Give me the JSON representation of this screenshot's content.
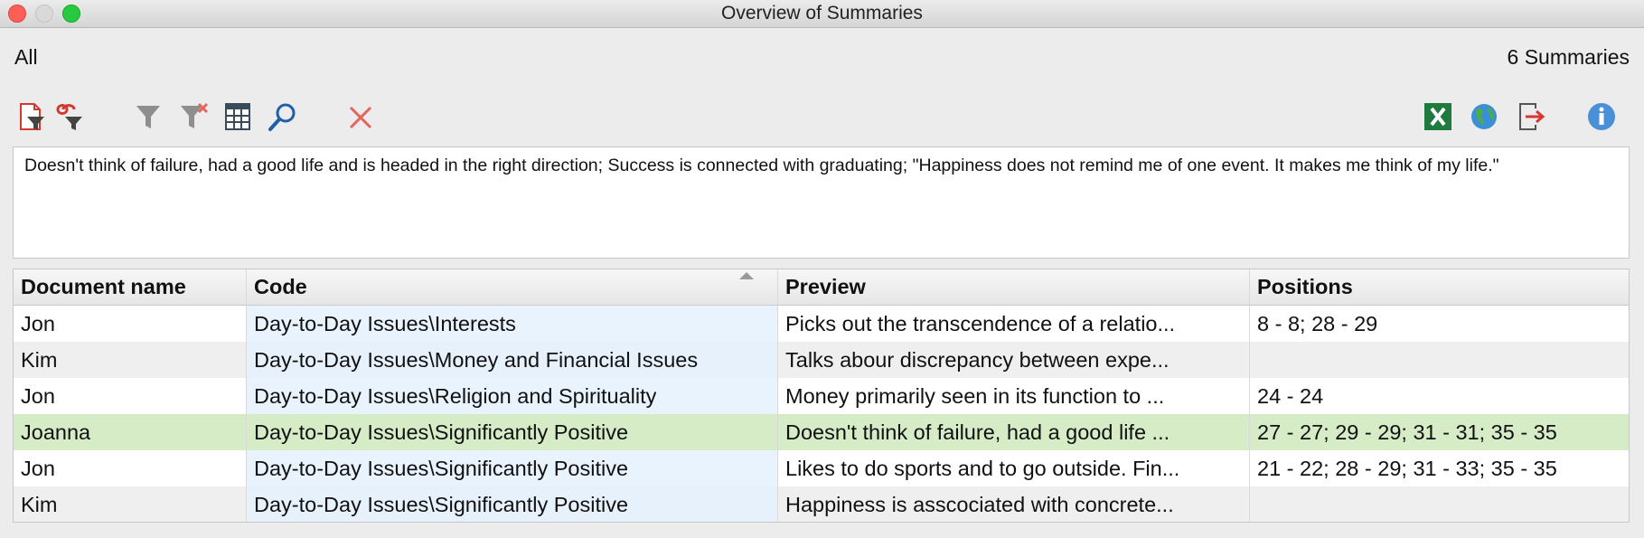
{
  "window": {
    "title": "Overview of Summaries"
  },
  "header": {
    "filter_label": "All",
    "count_label": "6 Summaries"
  },
  "toolbar": {
    "left_icons": [
      "document-filter-icon",
      "link-filter-icon",
      "filter-icon",
      "clear-filter-icon",
      "columns-icon",
      "search-icon",
      "delete-icon"
    ],
    "right_icons": [
      "excel-export-icon",
      "globe-export-icon",
      "export-icon",
      "info-icon"
    ]
  },
  "summary_text": "Doesn't think of failure, had a good life and is headed in the right direction; Success is connected with graduating; \"Happiness does not remind me of one event. It makes me think of my life.\"",
  "table": {
    "columns": [
      "Document name",
      "Code",
      "Preview",
      "Positions"
    ],
    "sorted_column": "Code",
    "rows": [
      {
        "document": "Jon",
        "code": "Day-to-Day Issues\\Interests",
        "preview": "Picks out the transcendence of a relatio...",
        "positions": "8 - 8; 28 - 29"
      },
      {
        "document": "Kim",
        "code": "Day-to-Day Issues\\Money and Financial Issues",
        "preview": "Talks abour discrepancy between expe...",
        "positions": ""
      },
      {
        "document": "Jon",
        "code": "Day-to-Day Issues\\Religion and Spirituality",
        "preview": "Money primarily seen in its function to ...",
        "positions": "24 - 24"
      },
      {
        "document": "Joanna",
        "code": "Day-to-Day Issues\\Significantly Positive",
        "preview": "Doesn't think of failure, had a good life ...",
        "positions": "27 - 27; 29 - 29; 31 - 31; 35 - 35"
      },
      {
        "document": "Jon",
        "code": "Day-to-Day Issues\\Significantly Positive",
        "preview": "Likes to do sports and to go outside. Fin...",
        "positions": "21 - 22; 28 - 29; 31 - 33; 35 - 35"
      },
      {
        "document": "Kim",
        "code": "Day-to-Day Issues\\Significantly Positive",
        "preview": "Happiness is asscociated with concrete...",
        "positions": ""
      }
    ],
    "selected_row_index": 3
  },
  "colors": {
    "selected_row": "#d5ecc7",
    "code_column": "#e8f3fd",
    "accent_blue": "#1f5fa8",
    "delete_red": "#e4655c"
  }
}
